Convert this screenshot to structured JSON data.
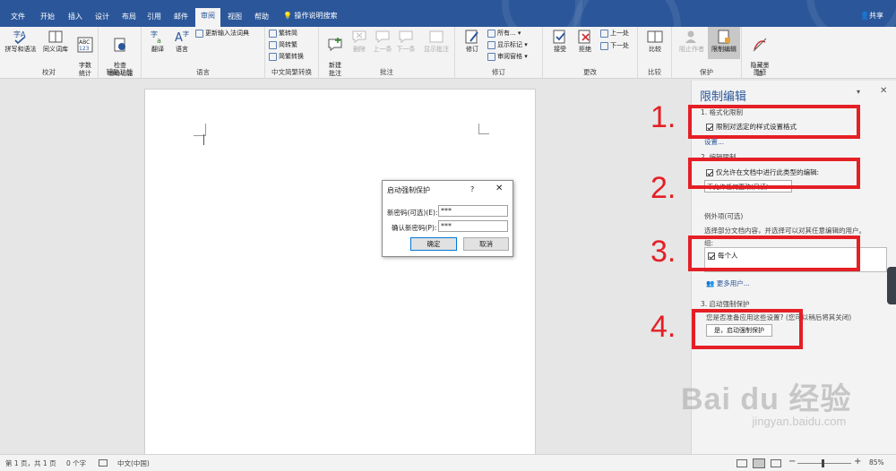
{
  "tabs": [
    "文件",
    "开始",
    "插入",
    "设计",
    "布局",
    "引用",
    "邮件",
    "审阅",
    "视图",
    "帮助"
  ],
  "active_tab": "审阅",
  "tell_me": "操作说明搜索",
  "share": "共享",
  "groups": {
    "proofing": {
      "label": "校对",
      "spell": "拼写和语法",
      "thesaurus": "同义词库",
      "wordcount": "字数\n统计"
    },
    "access": {
      "label": "辅助功能",
      "check": "检查\n辅助功能"
    },
    "language": {
      "label": "语言",
      "translate": "翻译",
      "lang": "语言",
      "update_ime": "更新输入法词典"
    },
    "chinese": {
      "label": "中文简繁转换",
      "t2s": "繁转简",
      "s2t": "简转繁",
      "conv": "简繁转换"
    },
    "comments": {
      "label": "批注",
      "new": "新建\n批注",
      "delete": "删除",
      "prev": "上一条",
      "next": "下一条",
      "show": "显示批注"
    },
    "tracking": {
      "label": "修订",
      "track": "修订",
      "markup": "所有...",
      "show_markup": "显示标记",
      "pane": "审阅窗格"
    },
    "changes": {
      "label": "更改",
      "accept": "接受",
      "reject": "拒绝",
      "prev": "上一处",
      "next": "下一处"
    },
    "compare": {
      "label": "比较",
      "compare": "比较"
    },
    "protect": {
      "label": "保护",
      "block": "阻止作者",
      "restrict": "限制编辑"
    },
    "ink": {
      "label": "墨迹",
      "hide": "隐藏墨\n迹"
    }
  },
  "dialog": {
    "title": "启动强制保护",
    "help": "?",
    "close": "✕",
    "new_pwd_label": "新密码(可选)(E):",
    "new_pwd_value": "***",
    "confirm_label": "确认新密码(P):",
    "confirm_value": "***",
    "ok": "确定",
    "cancel": "取消"
  },
  "panel": {
    "title": "限制编辑",
    "sec1": "1. 格式化限制",
    "sec1_check": "限制对选定的样式设置格式",
    "sec1_settings": "设置...",
    "sec2": "2. 编辑限制",
    "sec2_check": "仅允许在文档中进行此类型的编辑:",
    "sec2_select": "不允许任何更改(只读)",
    "exceptions": "例外项(可选)",
    "exceptions_desc": "选择部分文档内容，并选择可以对其任意编辑的用户。",
    "groups_label": "组:",
    "everyone": "每个人",
    "more_users": "更多用户...",
    "sec3": "3. 启动强制保护",
    "sec3_q": "您是否准备应用这些设置? (您可以稍后将其关闭)",
    "sec3_btn": "是，启动强制保护"
  },
  "annotations": [
    "1.",
    "2.",
    "3.",
    "4."
  ],
  "status": {
    "page": "第 1 页，共 1 页",
    "words": "0 个字",
    "lang": "中文(中国)",
    "zoom": "85%"
  },
  "watermark": {
    "main": "Bai du 经验",
    "sub": "jingyan.baidu.com"
  },
  "colors": {
    "title_bar": "#2b579a",
    "annotation_red": "#e41f25"
  }
}
